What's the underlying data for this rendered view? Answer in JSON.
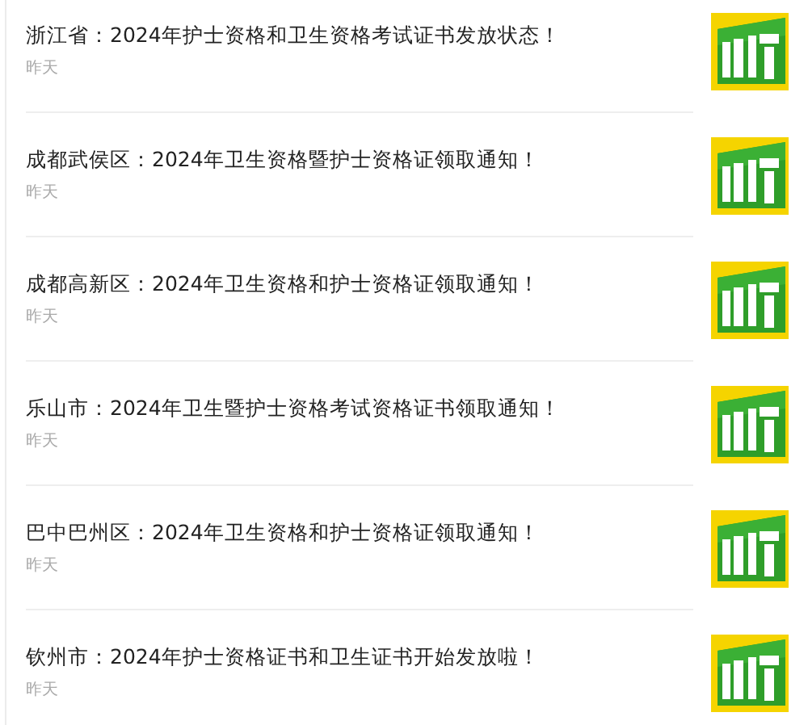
{
  "articles": [
    {
      "title": "浙江省：2024年护士资格和卫生资格考试证书发放状态！",
      "date": "昨天"
    },
    {
      "title": "成都武侯区：2024年卫生资格暨护士资格证领取通知！",
      "date": "昨天"
    },
    {
      "title": "成都高新区：2024年卫生资格和护士资格证领取通知！",
      "date": "昨天"
    },
    {
      "title": "乐山市：2024年卫生暨护士资格考试资格证书领取通知！",
      "date": "昨天"
    },
    {
      "title": "巴中巴州区：2024年卫生资格和护士资格证领取通知！",
      "date": "昨天"
    },
    {
      "title": "钦州市：2024年护士资格证书和卫生证书开始发放啦！",
      "date": "昨天"
    }
  ]
}
